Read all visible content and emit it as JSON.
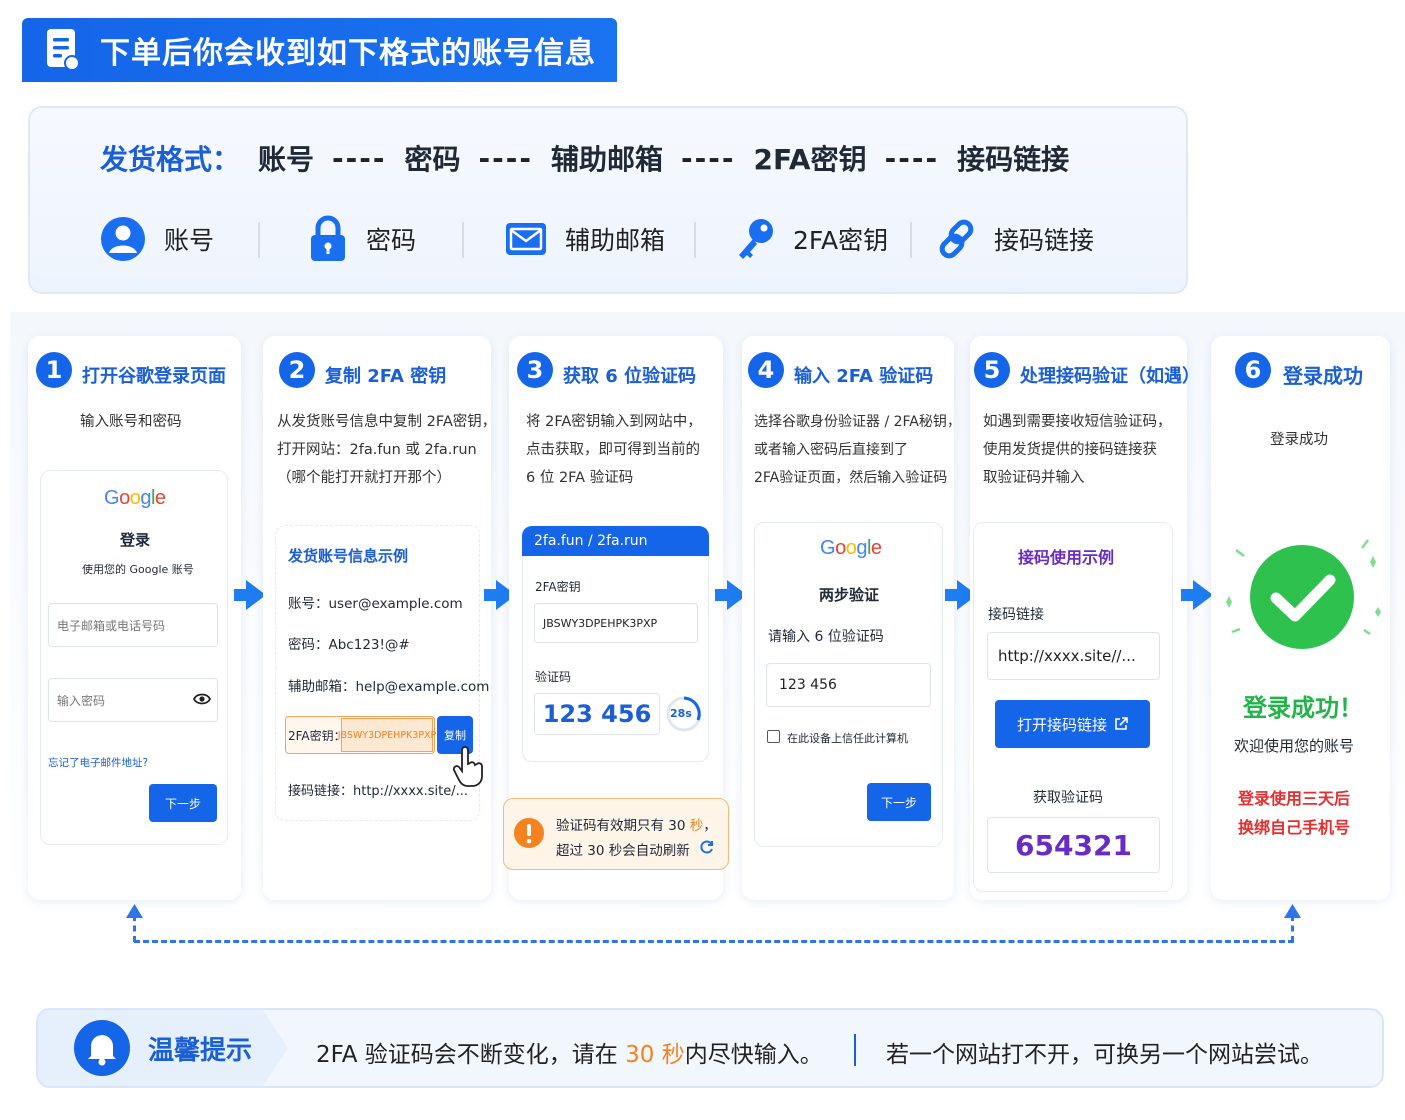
{
  "header": {
    "title": "下单后你会收到如下格式的账号信息",
    "icon": "document-icon"
  },
  "format": {
    "label": "发货格式：",
    "parts": [
      "账号",
      "----",
      "密码",
      "----",
      "辅助邮箱",
      "----",
      "2FA密钥",
      "----",
      "接码链接"
    ],
    "legend": [
      {
        "icon": "user-icon",
        "label": "账号"
      },
      {
        "icon": "lock-icon",
        "label": "密码"
      },
      {
        "icon": "mail-icon",
        "label": "辅助邮箱"
      },
      {
        "icon": "key-icon",
        "label": "2FA密钥"
      },
      {
        "icon": "link-icon",
        "label": "接码链接"
      }
    ]
  },
  "steps": [
    {
      "num": "1",
      "title": "打开谷歌登录页面",
      "desc": [
        "输入账号和密码"
      ],
      "mock": {
        "logo": "Google",
        "heading": "登录",
        "sub": "使用您的 Google 账号",
        "email_ph": "电子邮箱或电话号码",
        "pwd_ph": "输入密码",
        "forgot": "忘记了电子邮件地址?",
        "next": "下一步"
      }
    },
    {
      "num": "2",
      "title": "复制 2FA 密钥",
      "desc": [
        "从发货账号信息中复制 2FA密钥，",
        "打开网站：2fa.fun 或 2fa.run",
        "（哪个能打开就打开那个）"
      ],
      "mock": {
        "heading": "发货账号信息示例",
        "account": "账号：user@example.com",
        "password": "密码：Abc123!@#",
        "email": "辅助邮箱：help@example.com",
        "key_label": "2FA密钥：",
        "key_value": "JBSWY3DPEHPK3PXP",
        "copy": "复制",
        "link": "接码链接：http://xxxx.site/..."
      }
    },
    {
      "num": "3",
      "title": "获取 6 位验证码",
      "desc": [
        "将 2FA密钥输入到网站中，",
        "点击获取，即可得到当前的",
        "6 位 2FA 验证码"
      ],
      "mock": {
        "bar": "2fa.fun / 2fa.run",
        "key_label": "2FA密钥",
        "key_value": "JBSWY3DPEHPK3PXP",
        "code_label": "验证码",
        "code": "123 456",
        "timer": "28s"
      },
      "warn": {
        "line1_a": "验证码有效期只有 30 ",
        "line1_b": "秒",
        "line1_c": "，",
        "line2": "超过 30 秒会自动刷新"
      }
    },
    {
      "num": "4",
      "title": "输入 2FA 验证码",
      "desc": [
        "选择谷歌身份验证器 / 2FA秘钥，",
        "或者输入密码后直接到了",
        "2FA验证页面，然后输入验证码"
      ],
      "mock": {
        "logo": "Google",
        "heading": "两步验证",
        "prompt": "请输入 6 位验证码",
        "value": "123 456",
        "trust": "在此设备上信任此计算机",
        "next": "下一步"
      }
    },
    {
      "num": "5",
      "title": "处理接码验证（如遇）",
      "desc": [
        "如遇到需要接收短信验证码，",
        "使用发货提供的接码链接获",
        "取验证码并输入"
      ],
      "mock": {
        "heading": "接码使用示例",
        "link_label": "接码链接",
        "link_value": "http://xxxx.site//...",
        "open": "打开接码链接",
        "get_label": "获取验证码",
        "code": "654321"
      }
    },
    {
      "num": "6",
      "title": "登录成功",
      "desc": [
        "登录成功"
      ],
      "success": {
        "title": "登录成功！",
        "welcome": "欢迎使用您的账号",
        "note1": "登录使用三天后",
        "note2": "换绑自己手机号"
      }
    }
  ],
  "tip": {
    "title": "温馨提示",
    "text_a": "2FA 验证码会不断变化，请在 ",
    "text_b": "30 秒",
    "text_c": "内尽快输入。",
    "text2": "若一个网站打不开，可换另一个网站尝试。"
  },
  "colors": {
    "primary": "#1565e8",
    "orange": "#f5821f",
    "green": "#22b34a",
    "red": "#e62e2e",
    "purple": "#6a2bc4"
  }
}
